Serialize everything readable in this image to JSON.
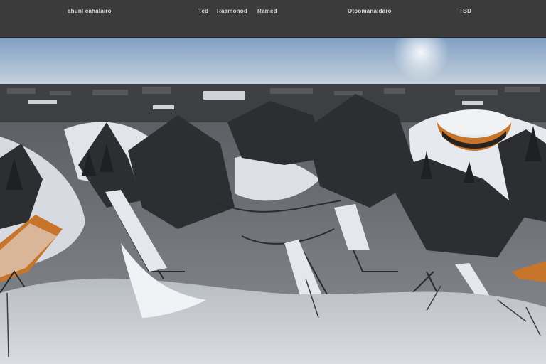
{
  "toolbar": {
    "left_title": "ahunl cahalairo",
    "mid_a": "Ted",
    "mid_b": "Raamonod",
    "mid_c": "Ramed",
    "right_a": "Otoomanaldaro",
    "right_b": "TBD"
  },
  "scene": {
    "description_icon": "panorama-image",
    "sky_top_color": "#7f9fc4",
    "sky_bottom_color": "#c9d3dd",
    "snow_color": "#e6e9ee",
    "building_accent": "#c7752a"
  }
}
